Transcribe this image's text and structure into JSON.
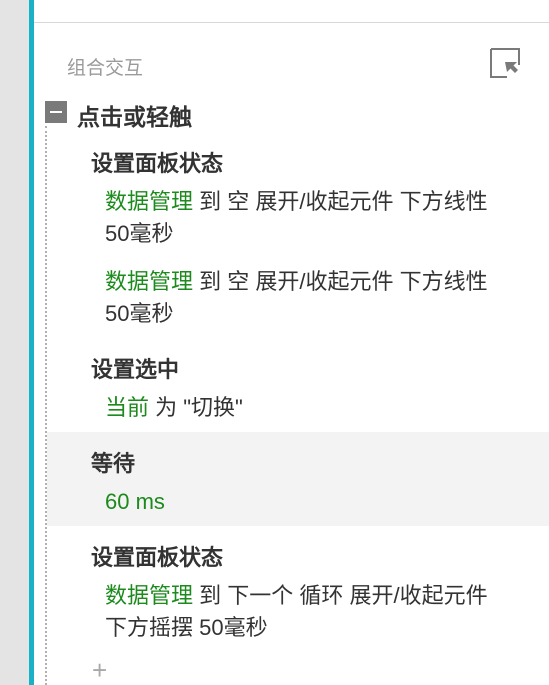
{
  "group_title": "组合交互",
  "event": {
    "label": "点击或轻触"
  },
  "actions": [
    {
      "title": "设置面板状态",
      "details": [
        {
          "target": "数据管理",
          "rest_line1": " 到 空 展开/收起元件 下方线性",
          "rest_line2": "50毫秒"
        },
        {
          "target": "数据管理",
          "rest_line1": " 到 空 展开/收起元件 下方线性",
          "rest_line2": "50毫秒"
        }
      ]
    },
    {
      "title": "设置选中",
      "details": [
        {
          "target": "当前",
          "rest": " 为 \"切换\""
        }
      ]
    },
    {
      "title": "等待",
      "details": [
        {
          "target": "60 ms"
        }
      ]
    },
    {
      "title": "设置面板状态",
      "details": [
        {
          "target": "数据管理",
          "rest_line1": " 到 下一个 循环 展开/收起元件",
          "rest_line2": "下方摇摆 50毫秒"
        }
      ]
    }
  ],
  "add_label": "+",
  "icons": {
    "collapse": "minus-square-icon",
    "corner": "select-region-icon"
  },
  "colors": {
    "accent": "#1ab0c6",
    "target_text": "#1c8a1c",
    "gutter": "#e4e4e4"
  }
}
